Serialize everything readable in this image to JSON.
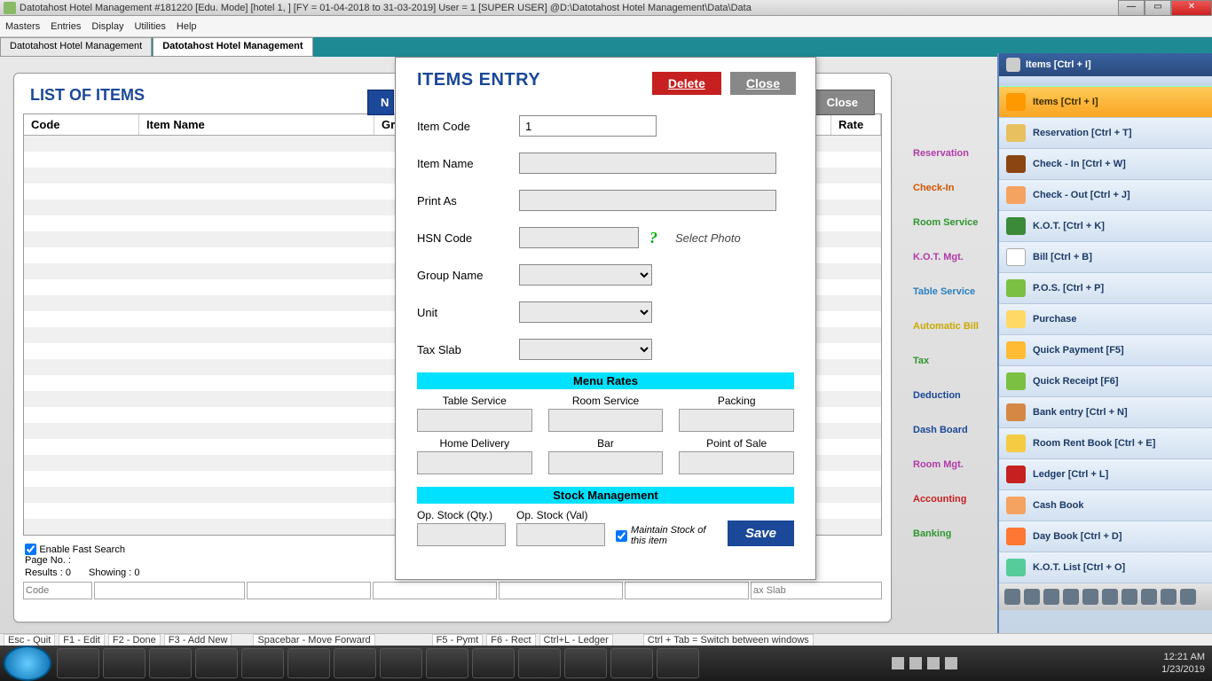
{
  "window": {
    "title": "Datotahost Hotel Management #181220  [Edu. Mode]  [hotel 1, ] [FY = 01-04-2018 to 31-03-2019] User = 1 [SUPER USER]  @D:\\Datotahost Hotel Management\\Data\\Data"
  },
  "menu": {
    "items": [
      "Masters",
      "Entries",
      "Display",
      "Utilities",
      "Help"
    ]
  },
  "mdi": {
    "tabs": [
      "Datotahost Hotel Management",
      "Datotahost Hotel Management"
    ]
  },
  "list": {
    "title": "LIST OF ITEMS",
    "new": "N",
    "close": "Close",
    "cols": {
      "code": "Code",
      "name": "Item Name",
      "group": "Group",
      "rate": "Rate"
    },
    "fast_search": "Enable Fast Search",
    "pageno": "Page No. :",
    "results": "Results : 0",
    "showing": "Showing :   0",
    "search_code": "Code",
    "search_slab": "ax Slab"
  },
  "dlg": {
    "title": "ITEMS ENTRY",
    "delete": "Delete",
    "close": "Close",
    "item_code_lbl": "Item Code",
    "item_code_val": "1",
    "item_name_lbl": "Item Name",
    "print_as_lbl": "Print As",
    "hsn_lbl": "HSN Code",
    "photo": "Select Photo",
    "group_lbl": "Group Name",
    "unit_lbl": "Unit",
    "tax_lbl": "Tax Slab",
    "menu_rates": "Menu Rates",
    "rates": {
      "table": "Table Service",
      "room": "Room Service",
      "packing": "Packing",
      "home": "Home Delivery",
      "bar": "Bar",
      "pos": "Point of Sale"
    },
    "stock_mgmt": "Stock Management",
    "op_qty": "Op. Stock (Qty.)",
    "op_val": "Op. Stock (Val)",
    "maintain": "Maintain Stock of this item",
    "save": "Save"
  },
  "bg": {
    "l1": "Reservation",
    "l2": "Check-In",
    "l3": "Room Service",
    "l4": "K.O.T. Mgt.",
    "l5": "Table Service",
    "l6": "Automatic Bill",
    "l7": "Tax",
    "l8": "Deduction",
    "l9": "Dash Board",
    "l10": "Room Mgt.",
    "l11": "Accounting",
    "l12": "Banking"
  },
  "sidebar": {
    "title": "Items [Ctrl + I]",
    "items": [
      "Items [Ctrl + I]",
      "Reservation [Ctrl + T]",
      "Check - In [Ctrl + W]",
      "Check - Out [Ctrl + J]",
      "K.O.T. [Ctrl + K]",
      "Bill [Ctrl + B]",
      "P.O.S. [Ctrl + P]",
      "Purchase",
      "Quick Payment [F5]",
      "Quick Receipt [F6]",
      "Bank entry [Ctrl + N]",
      "Room Rent Book [Ctrl + E]",
      "Ledger [Ctrl + L]",
      "Cash Book",
      "Day Book [Ctrl + D]",
      "K.O.T. List [Ctrl + O]"
    ]
  },
  "help": {
    "esc": "Esc - Quit",
    "f1": "F1 - Edit",
    "f2": "F2 - Done",
    "f3": "F3 - Add New",
    "space": "Spacebar - Move Forward",
    "f5": "F5 - Pymt",
    "f6": "F6 - Rect",
    "ctrll": "Ctrl+L - Ledger",
    "ctrltab": "Ctrl + Tab = Switch between windows"
  },
  "tray": {
    "time": "12:21 AM",
    "date": "1/23/2019"
  }
}
